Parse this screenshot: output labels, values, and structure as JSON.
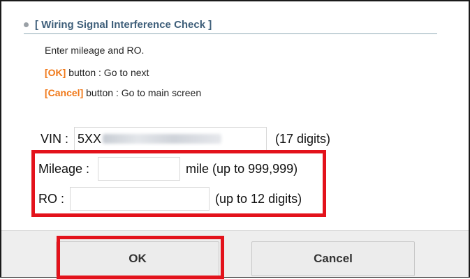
{
  "dialog": {
    "section_title": "[ Wiring Signal Interference Check ]",
    "instruction": "Enter mileage and RO.",
    "ok_hint": {
      "key": "[OK]",
      "text": " button : Go to next"
    },
    "cancel_hint": {
      "key": "[Cancel]",
      "text": " button : Go to main screen"
    }
  },
  "form": {
    "vin": {
      "label": "VIN :",
      "value_prefix": "5XX",
      "hint": "(17 digits)"
    },
    "mileage": {
      "label": "Mileage :",
      "value": "",
      "hint": "mile (up to 999,999)"
    },
    "ro": {
      "label": "RO :",
      "value": "",
      "hint": "(up to 12 digits)"
    }
  },
  "buttons": {
    "ok": "OK",
    "cancel": "Cancel"
  },
  "colors": {
    "accent_orange": "#f07818",
    "title_blue": "#3f5f7a",
    "highlight_red": "#e3121b"
  }
}
